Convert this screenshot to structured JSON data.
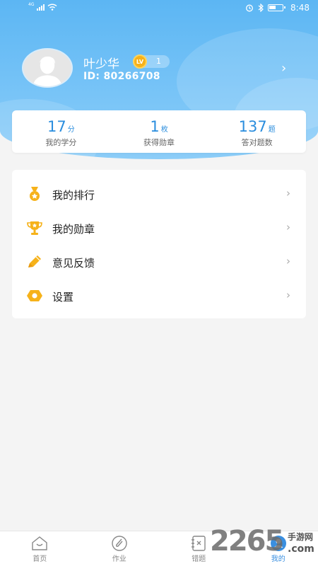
{
  "status_bar": {
    "network": "4G",
    "time": "8:48"
  },
  "profile": {
    "name": "叶少华",
    "level_badge": "LV",
    "level": "1",
    "user_id": "ID: 80266708"
  },
  "stats": [
    {
      "value": "17",
      "unit": "分",
      "label": "我的学分"
    },
    {
      "value": "1",
      "unit": "枚",
      "label": "获得勋章"
    },
    {
      "value": "137",
      "unit": "题",
      "label": "答对题数"
    }
  ],
  "menu": [
    {
      "label": "我的排行",
      "icon": "ranking-medal-icon"
    },
    {
      "label": "我的勋章",
      "icon": "trophy-icon"
    },
    {
      "label": "意见反馈",
      "icon": "pencil-icon"
    },
    {
      "label": "设置",
      "icon": "settings-hex-icon"
    }
  ],
  "tabs": [
    {
      "label": "首页",
      "icon": "home-icon",
      "active": false
    },
    {
      "label": "作业",
      "icon": "paperclip-icon",
      "active": false
    },
    {
      "label": "错题",
      "icon": "wrong-notebook-icon",
      "active": false
    },
    {
      "label": "我的",
      "icon": "profile-icon",
      "active": true
    }
  ],
  "watermark": {
    "number": "2265",
    "text1": "手游网",
    "text2": ".com"
  },
  "colors": {
    "header_top": "#5cb6f3",
    "header_bottom": "#8ccdf8",
    "accent_blue": "#2b8ede",
    "icon_yellow": "#f6b21a",
    "page_bg": "#f4f4f4"
  }
}
